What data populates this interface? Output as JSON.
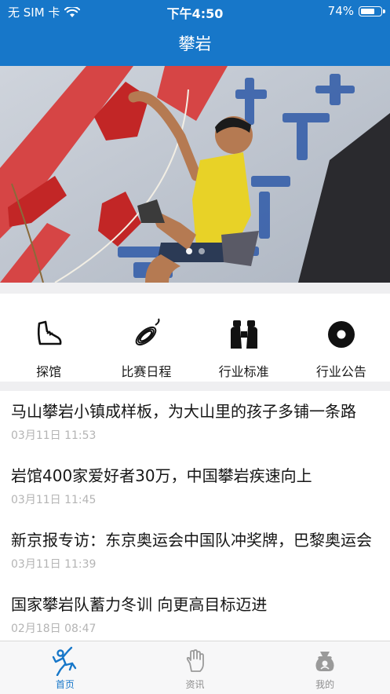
{
  "status_bar": {
    "carrier": "无 SIM 卡",
    "time": "下午4:50",
    "battery_percent": "74%",
    "battery_level": 0.74
  },
  "nav": {
    "title": "攀岩"
  },
  "banner": {
    "slide_count": 2,
    "active_slide": 0
  },
  "categories": [
    {
      "label": "探馆",
      "icon": "shoe-icon"
    },
    {
      "label": "比赛日程",
      "icon": "rope-icon"
    },
    {
      "label": "行业标准",
      "icon": "binoculars-icon"
    },
    {
      "label": "行业公告",
      "icon": "disc-icon"
    }
  ],
  "news": [
    {
      "title": "马山攀岩小镇成样板，为大山里的孩子多铺一条路",
      "date": "03月11日 11:53"
    },
    {
      "title": "岩馆400家爱好者30万，中国攀岩疾速向上",
      "date": "03月11日 11:45"
    },
    {
      "title": "新京报专访：东京奥运会中国队冲奖牌，巴黎奥运会",
      "date": "03月11日 11:39"
    },
    {
      "title": "国家攀岩队蓄力冬训 向更高目标迈进",
      "date": "02月18日 08:47"
    }
  ],
  "tabs": [
    {
      "label": "首页",
      "icon": "climber-icon",
      "active": true
    },
    {
      "label": "资讯",
      "icon": "hand-icon",
      "active": false
    },
    {
      "label": "我的",
      "icon": "profile-bag-icon",
      "active": false
    }
  ],
  "colors": {
    "primary": "#1777c9",
    "separator": "#efeff1",
    "date_gray": "#b4b4b4"
  }
}
